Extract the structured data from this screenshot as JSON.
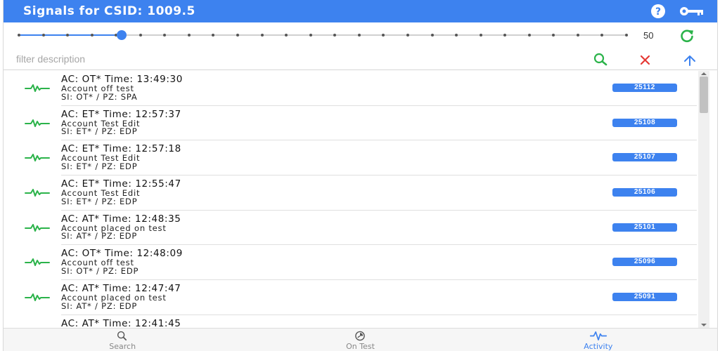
{
  "header": {
    "title": "Signals for CSID: 1009.5",
    "help_icon": "help-circle-icon",
    "key_icon": "key-icon"
  },
  "slider": {
    "value": 50,
    "value_label": "50",
    "fraction": 0.17,
    "tick_count": 26
  },
  "filter": {
    "value": "",
    "placeholder": "filter description",
    "search_icon": "search-icon",
    "clear_icon": "close-icon",
    "up_icon": "arrow-up-icon"
  },
  "colors": {
    "accent": "#3d82ef",
    "green": "#2bb34a",
    "red": "#e53935"
  },
  "signals": [
    {
      "line1": "AC: OT* Time: 13:49:30",
      "line2": "Account off test",
      "line3": "SI: OT* / PZ: SPA",
      "badge": "25112"
    },
    {
      "line1": "AC: ET* Time: 12:57:37",
      "line2": "Account Test Edit",
      "line3": "SI: ET* / PZ: EDP",
      "badge": "25108"
    },
    {
      "line1": "AC: ET* Time: 12:57:18",
      "line2": "Account Test Edit",
      "line3": "SI: ET* / PZ: EDP",
      "badge": "25107"
    },
    {
      "line1": "AC: ET* Time: 12:55:47",
      "line2": "Account Test Edit",
      "line3": "SI: ET* / PZ: EDP",
      "badge": "25106"
    },
    {
      "line1": "AC: AT* Time: 12:48:35",
      "line2": "Account placed on test",
      "line3": "SI: AT* / PZ: EDP",
      "badge": "25101"
    },
    {
      "line1": "AC: OT* Time: 12:48:09",
      "line2": "Account off test",
      "line3": "SI: OT* / PZ: EDP",
      "badge": "25096"
    },
    {
      "line1": "AC: AT* Time: 12:47:47",
      "line2": "Account placed on test",
      "line3": "SI: AT* / PZ: EDP",
      "badge": "25091"
    },
    {
      "line1": "AC: AT* Time: 12:41:45",
      "line2": "",
      "line3": "",
      "badge": ""
    }
  ],
  "nav": {
    "tabs": [
      {
        "label": "Search",
        "icon": "search-icon",
        "active": false
      },
      {
        "label": "On Test",
        "icon": "test-timer-icon",
        "active": false
      },
      {
        "label": "Activity",
        "icon": "pulse-icon",
        "active": true
      }
    ]
  }
}
